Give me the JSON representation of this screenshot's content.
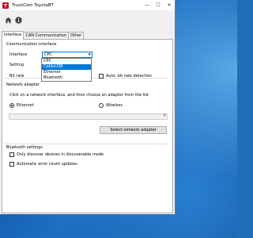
{
  "window": {
    "title": "TruckCom ToyotaBT"
  },
  "window_controls": {
    "minimize": "—",
    "maximize": "☐",
    "close": "✕"
  },
  "toolbar": {
    "home_icon": "home-icon",
    "info_icon": "info-icon"
  },
  "tabs": [
    {
      "label": "Interface",
      "active": true
    },
    {
      "label": "CAN Communication",
      "active": false
    },
    {
      "label": "Other",
      "active": false
    }
  ],
  "communication_interface": {
    "group_label": "Communication interface",
    "interface_label": "Interface",
    "interface_value": "CPC",
    "setting_label": "Setting",
    "bit_rate_label": "Bit rate",
    "auto_bitrate_label": "Auto. bit rate detection",
    "dropdown_options": [
      "CPC",
      "CobluUSB",
      "Ethernet",
      "Bluetooth"
    ],
    "dropdown_selected_index": 1
  },
  "network_adapter": {
    "group_label": "Network adapter",
    "instructions": "Click on a network interface, and then choose an adapter from the list",
    "ethernet_label": "Ethernet",
    "wireless_label": "Wireless",
    "select_button_label": "Select network adapter"
  },
  "bluetooth_settings": {
    "group_label": "Bluetooth settings",
    "discoverable_label": "Only discover devices in discoverable mode",
    "auto_error_label": "Automatic error count updates"
  },
  "colors": {
    "accent": "#0078d7",
    "app_red": "#c8102e"
  }
}
